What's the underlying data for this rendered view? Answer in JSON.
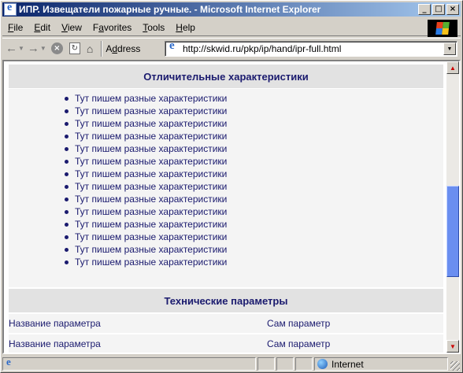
{
  "window": {
    "title": "ИПР. Извещатели пожарные ручные. - Microsoft Internet Explorer",
    "controls": {
      "minimize": "_",
      "maximize": "□",
      "close": "×"
    }
  },
  "menu": {
    "items": [
      {
        "accel": "F",
        "rest": "ile"
      },
      {
        "accel": "E",
        "rest": "dit"
      },
      {
        "accel": "V",
        "rest": "iew"
      },
      {
        "pre": "F",
        "accel": "a",
        "rest": "vorites"
      },
      {
        "accel": "T",
        "rest": "ools"
      },
      {
        "accel": "H",
        "rest": "elp"
      }
    ]
  },
  "toolbar": {
    "back_icon": "←",
    "dropdown_icon": "▼",
    "forward_icon": "→",
    "stop_icon": "×",
    "refresh_icon": "↻",
    "home_icon": "⌂",
    "address_label_accel": "d",
    "address_label_pre": "A",
    "address_label_rest": "dress",
    "url": "http://skwid.ru/pkp/ip/hand/ipr-full.html",
    "address_dropdown_icon": "▼"
  },
  "page": {
    "features_header": "Отличительные характеристики",
    "features": [
      "Тут пишем разные характеристики",
      "Тут пишем разные характеристики",
      "Тут пишем разные характеристики",
      "Тут пишем разные характеристики",
      "Тут пишем разные характеристики",
      "Тут пишем разные характеристики",
      "Тут пишем разные характеристики",
      "Тут пишем разные характеристики",
      "Тут пишем разные характеристики",
      "Тут пишем разные характеристики",
      "Тут пишем разные характеристики",
      "Тут пишем разные характеристики",
      "Тут пишем разные характеристики",
      "Тут пишем разные характеристики"
    ],
    "params_header": "Технические параметры",
    "params": [
      {
        "name": "Название параметра",
        "value": "Сам параметр"
      },
      {
        "name": "Название параметра",
        "value": "Сам параметр"
      }
    ]
  },
  "scrollbar": {
    "up_icon": "▲",
    "down_icon": "▼",
    "position_fraction": 0.55
  },
  "status": {
    "zone": "Internet"
  }
}
